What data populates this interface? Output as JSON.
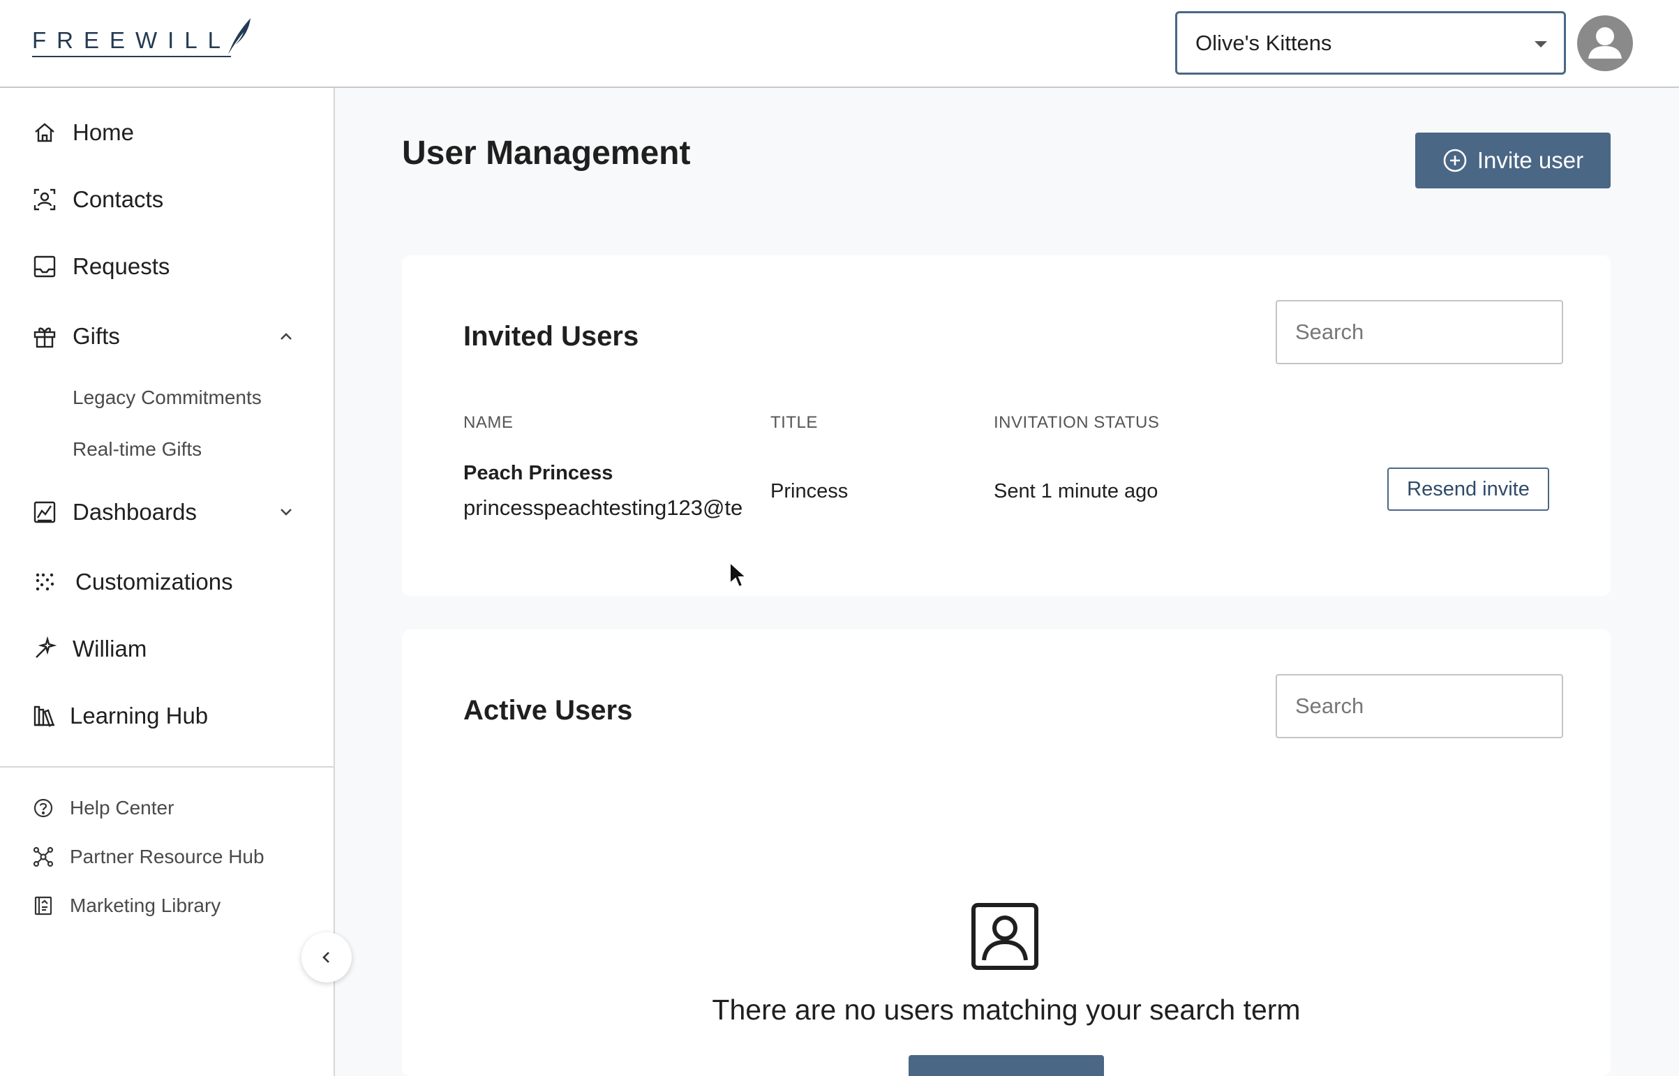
{
  "header": {
    "logo_text": "FREEWILL",
    "org_select": {
      "value": "Olive's Kittens",
      "icon": "caret-down-icon"
    },
    "avatar_icon": "user-avatar-icon"
  },
  "sidebar": {
    "items": [
      {
        "label": "Home",
        "icon": "home-icon"
      },
      {
        "label": "Contacts",
        "icon": "contacts-icon"
      },
      {
        "label": "Requests",
        "icon": "inbox-icon"
      },
      {
        "label": "Gifts",
        "icon": "gift-icon",
        "expanded": true,
        "children": [
          "Legacy Commitments",
          "Real-time Gifts"
        ]
      },
      {
        "label": "Dashboards",
        "icon": "chart-icon",
        "expanded": false
      },
      {
        "label": "Customizations",
        "icon": "sparkle-dots-icon"
      },
      {
        "label": "William",
        "icon": "magic-wand-icon"
      },
      {
        "label": "Learning Hub",
        "icon": "books-icon"
      }
    ],
    "footer": [
      {
        "label": "Help Center",
        "icon": "help-circle-icon"
      },
      {
        "label": "Partner Resource Hub",
        "icon": "network-icon"
      },
      {
        "label": "Marketing Library",
        "icon": "library-icon"
      }
    ]
  },
  "main": {
    "title": "User Management",
    "invite_button": "Invite user",
    "invited": {
      "title": "Invited Users",
      "search_placeholder": "Search",
      "columns": [
        "NAME",
        "TITLE",
        "INVITATION STATUS"
      ],
      "rows": [
        {
          "name": "Peach Princess",
          "email": "princesspeachtesting123@te",
          "title": "Princess",
          "status": "Sent 1 minute ago",
          "action": "Resend invite"
        }
      ]
    },
    "active": {
      "title": "Active Users",
      "search_placeholder": "Search",
      "empty_message": "There are no users matching your search term"
    }
  },
  "colors": {
    "primary": "#4a6785",
    "logo": "#243a52",
    "background": "#f8f9fa"
  }
}
